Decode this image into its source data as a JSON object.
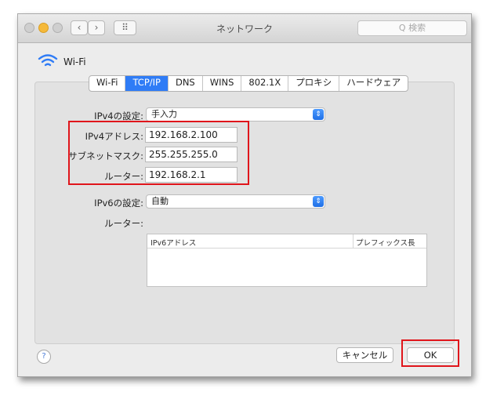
{
  "window": {
    "title": "ネットワーク",
    "search_placeholder": "Q 検索",
    "back_glyph": "‹",
    "forward_glyph": "›",
    "grid_glyph": "⠿"
  },
  "interface": {
    "name": "Wi-Fi",
    "icon": "wifi-icon"
  },
  "tabs": [
    {
      "label": "Wi-Fi"
    },
    {
      "label": "TCP/IP"
    },
    {
      "label": "DNS"
    },
    {
      "label": "WINS"
    },
    {
      "label": "802.1X"
    },
    {
      "label": "プロキシ"
    },
    {
      "label": "ハードウェア"
    }
  ],
  "active_tab": "TCP/IP",
  "ipv4": {
    "config_label": "IPv4の設定:",
    "config_value": "手入力",
    "address_label": "IPv4アドレス:",
    "address_value": "192.168.2.100",
    "subnet_label": "サブネットマスク:",
    "subnet_value": "255.255.255.0",
    "router_label": "ルーター:",
    "router_value": "192.168.2.1"
  },
  "ipv6": {
    "config_label": "IPv6の設定:",
    "config_value": "自動",
    "router_label": "ルーター:",
    "table_headers": [
      "IPv6アドレス",
      "プレフィックス長"
    ]
  },
  "buttons": {
    "help": "?",
    "cancel": "キャンセル",
    "ok": "OK"
  },
  "colors": {
    "accent": "#2f7cf6",
    "highlight": "#e0151b"
  }
}
